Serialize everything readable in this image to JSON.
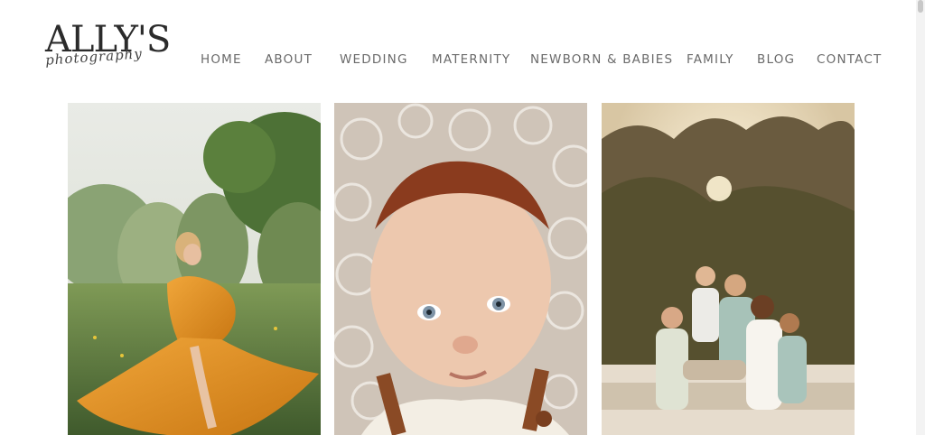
{
  "logo": {
    "text": "ALLY'S",
    "script": "photography"
  },
  "nav": {
    "items": [
      {
        "label": "HOME"
      },
      {
        "label": "ABOUT"
      },
      {
        "label": "WEDDING"
      },
      {
        "label": "MATERNITY"
      },
      {
        "label": "NEWBORN & BABIES"
      },
      {
        "label": "FAMILY"
      },
      {
        "label": "BLOG"
      },
      {
        "label": "CONTACT"
      }
    ]
  },
  "gallery": [
    {
      "subject": "maternity-photo"
    },
    {
      "subject": "newborn-photo"
    },
    {
      "subject": "family-photo"
    }
  ],
  "colors": {
    "nav_text": "#6a6a6a",
    "logo": "#2b2b2b",
    "background": "#ffffff"
  }
}
